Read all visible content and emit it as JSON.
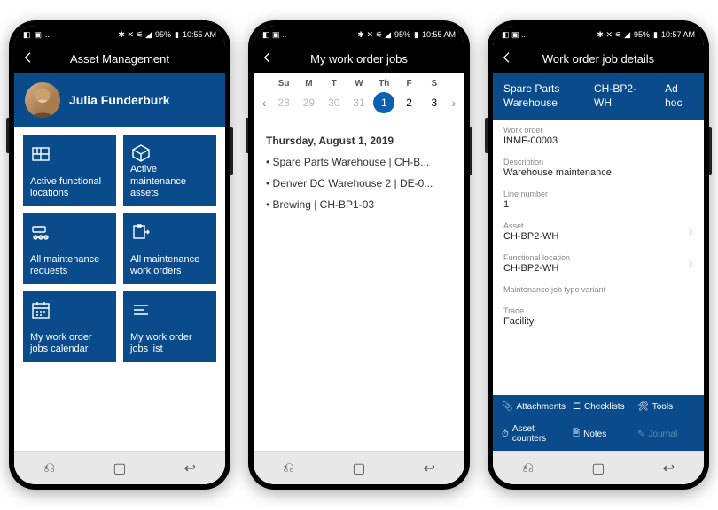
{
  "status": {
    "time1": "10:55 AM",
    "time2": "10:55 AM",
    "time3": "10:57 AM",
    "battery": "95%"
  },
  "phone1": {
    "title": "Asset Management",
    "user": "Julia Funderburk",
    "tiles": [
      {
        "label": "Active functional locations"
      },
      {
        "label": "Active maintenance assets"
      },
      {
        "label": "All maintenance requests"
      },
      {
        "label": "All maintenance work orders"
      },
      {
        "label": "My work order jobs calendar"
      },
      {
        "label": "My work order jobs list"
      }
    ]
  },
  "phone2": {
    "title": "My work order jobs",
    "daysOfWeek": [
      "Su",
      "M",
      "T",
      "W",
      "Th",
      "F",
      "S"
    ],
    "dates": [
      "28",
      "29",
      "30",
      "31",
      "1",
      "2",
      "3"
    ],
    "selectedIndex": 4,
    "dateHeading": "Thursday, August 1, 2019",
    "items": [
      "Spare Parts Warehouse | CH-B...",
      "Denver DC Warehouse 2 | DE-0...",
      "Brewing | CH-BP1-03"
    ]
  },
  "phone3": {
    "title": "Work order job details",
    "pills": [
      "Spare Parts Warehouse",
      "CH-BP2-WH",
      "Ad hoc"
    ],
    "fields": {
      "workOrderLbl": "Work order",
      "workOrder": "INMF-00003",
      "descLbl": "Description",
      "desc": "Warehouse maintenance",
      "lineLbl": "Line number",
      "line": "1",
      "assetLbl": "Asset",
      "asset": "CH-BP2-WH",
      "flocLbl": "Functional location",
      "floc": "CH-BP2-WH",
      "variantLbl": "Maintenance job type variant",
      "variant": "",
      "tradeLbl": "Trade",
      "trade": "Facility"
    },
    "toolbar": [
      "Attachments",
      "Checklists",
      "Tools",
      "Asset counters",
      "Notes",
      "Journal"
    ]
  }
}
